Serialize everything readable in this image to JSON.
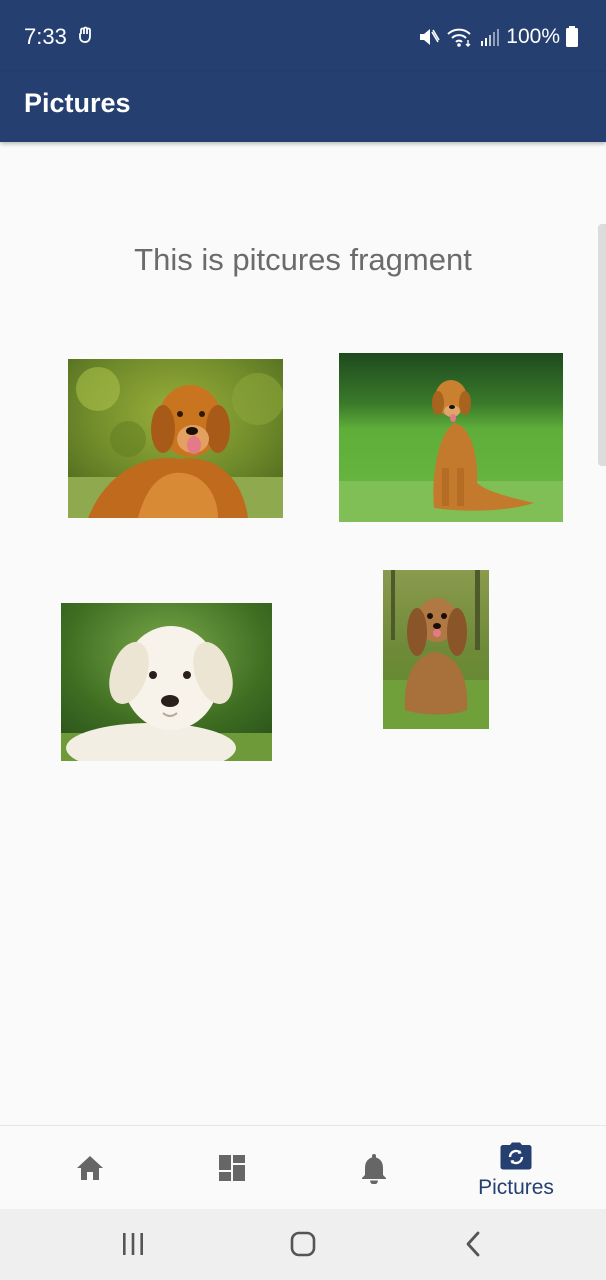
{
  "status_bar": {
    "time": "7:33",
    "battery": "100%"
  },
  "app_bar": {
    "title": "Pictures"
  },
  "content": {
    "fragment_text": "This is pitcures fragment"
  },
  "bottom_nav": {
    "items": [
      {
        "icon": "home-icon",
        "label": ""
      },
      {
        "icon": "dashboard-icon",
        "label": ""
      },
      {
        "icon": "bell-icon",
        "label": ""
      },
      {
        "icon": "camera-icon",
        "label": "Pictures",
        "selected": true
      }
    ]
  },
  "colors": {
    "primary": "#243f70",
    "background": "#fafafa",
    "text_secondary": "#6b6b6b",
    "nav_inactive": "#666666"
  }
}
